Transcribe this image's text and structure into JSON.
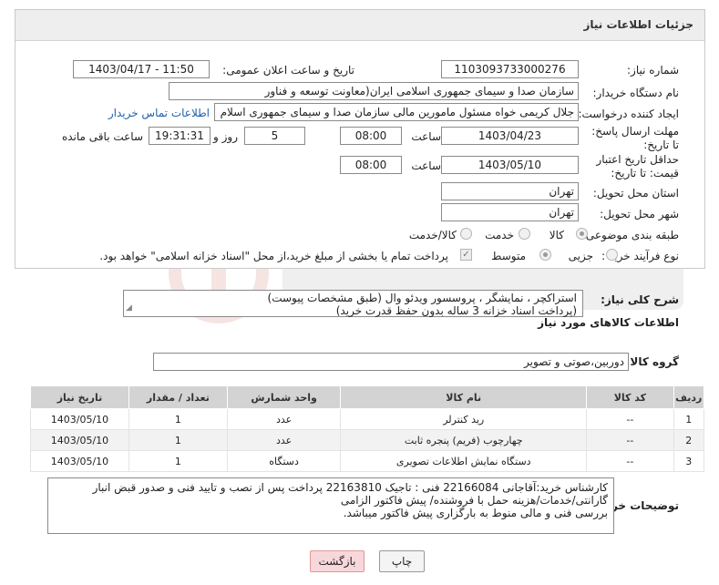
{
  "panel": {
    "title": "جزئیات اطلاعات نیاز"
  },
  "fields": {
    "need_number_label": "شماره نیاز:",
    "need_number": "1103093733000276",
    "announce_label": "تاریخ و ساعت اعلان عمومی:",
    "announce_value": "1403/04/17 - 11:50",
    "buyer_org_label": "نام دستگاه خریدار:",
    "buyer_org": "سازمان صدا و سیمای جمهوری اسلامی ایران(معاونت توسعه و فناور",
    "creator_label": "ایجاد کننده درخواست:",
    "creator": "جلال کریمی خواه مسئول مامورین مالی  سازمان صدا و سیمای جمهوری اسلام",
    "contact_link": "اطلاعات تماس خریدار",
    "reply_deadline_label": "مهلت ارسال پاسخ: تا تاریخ:",
    "reply_date": "1403/04/23",
    "time_label": "ساعت",
    "reply_time": "08:00",
    "days": "5",
    "days_and_label": "روز و",
    "remaining_time": "19:31:31",
    "remaining_label": "ساعت باقی مانده",
    "validity_label": "حداقل تاریخ اعتبار قیمت: تا تاریخ:",
    "validity_date": "1403/05/10",
    "validity_time": "08:00",
    "province_label": "استان محل تحویل:",
    "province": "تهران",
    "city_label": "شهر محل تحویل:",
    "city": "تهران",
    "category_label": "طبقه بندی موضوعی:",
    "category_options": [
      "کالا",
      "خدمت",
      "کالا/خدمت"
    ],
    "process_label": "نوع فرآیند خرید :",
    "process_options": [
      "جزیی",
      "متوسط"
    ],
    "payment_note": "پرداخت تمام یا بخشی از مبلغ خرید،از محل \"اسناد خزانه اسلامی\" خواهد بود."
  },
  "description": {
    "label": "شرح کلی نیاز:",
    "line1": "استراکچر ، نمایشگر ، پروسسور ویدئو وال (طبق مشخصات پیوست)",
    "line2": "(پرداخت اسناد خزانه 3 ساله بدون حفظ قدرت خرید)"
  },
  "goods": {
    "section_title": "اطلاعات کالاهای مورد نیاز",
    "group_label": "گروه کالا:",
    "group_value": "دوربین،صوتی و تصویر",
    "columns": [
      "ردیف",
      "کد کالا",
      "نام کالا",
      "واحد شمارش",
      "تعداد / مقدار",
      "تاریخ نیاز"
    ],
    "rows": [
      {
        "idx": "1",
        "code": "--",
        "name": "رید کنترلر",
        "unit": "عدد",
        "qty": "1",
        "date": "1403/05/10"
      },
      {
        "idx": "2",
        "code": "--",
        "name": "چهارچوب (فریم) پنجره ثابت",
        "unit": "عدد",
        "qty": "1",
        "date": "1403/05/10"
      },
      {
        "idx": "3",
        "code": "--",
        "name": "دستگاه نمایش اطلاعات تصویری",
        "unit": "دستگاه",
        "qty": "1",
        "date": "1403/05/10"
      }
    ]
  },
  "buyer_notes": {
    "label": "توضیحات خریدار:",
    "line1": "کارشناس خرید:آقاجانی 22166084  فنی : تاجیک 22163810 پرداخت پس از نصب و تایید فنی و صدور قبض انبار",
    "line2": "گارانتی/خدمات/هزینه حمل با فروشنده/ پیش فاکتور الزامی",
    "line3": "بررسی فنی و مالی منوط به بارگزاری پیش فاکتور میباشد."
  },
  "buttons": {
    "print": "چاپ",
    "back": "بازگشت"
  },
  "colors": {
    "header_bg": "#eeeeee",
    "table_header_bg": "#d3d3d3",
    "link": "#1f5fb0",
    "back_button_bg": "#f8d7da"
  }
}
